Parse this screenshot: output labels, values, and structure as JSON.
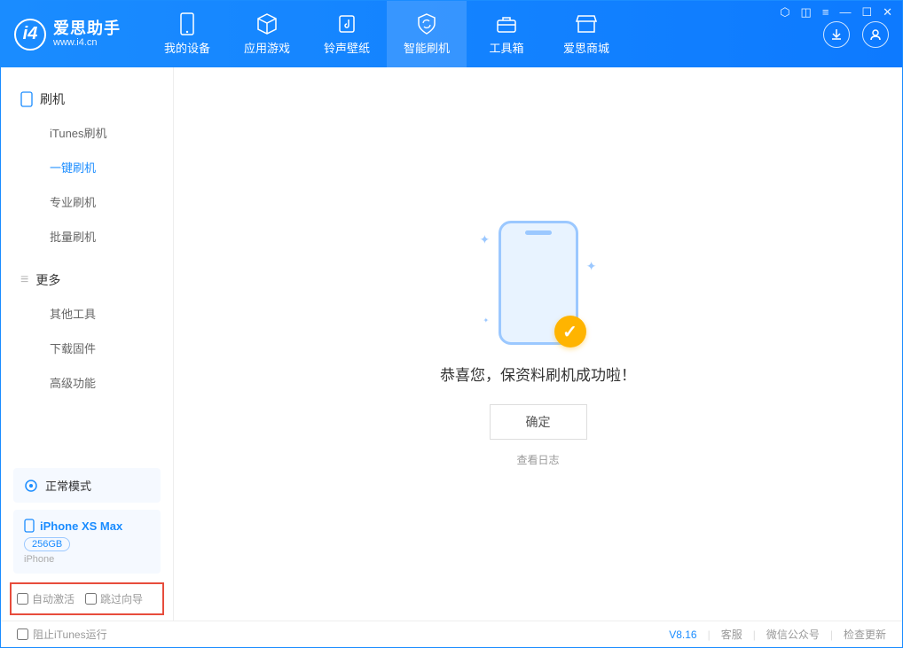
{
  "app": {
    "name": "爱思助手",
    "url": "www.i4.cn"
  },
  "nav": {
    "items": [
      {
        "label": "我的设备"
      },
      {
        "label": "应用游戏"
      },
      {
        "label": "铃声壁纸"
      },
      {
        "label": "智能刷机"
      },
      {
        "label": "工具箱"
      },
      {
        "label": "爱思商城"
      }
    ]
  },
  "sidebar": {
    "section1_title": "刷机",
    "items1": [
      {
        "label": "iTunes刷机"
      },
      {
        "label": "一键刷机"
      },
      {
        "label": "专业刷机"
      },
      {
        "label": "批量刷机"
      }
    ],
    "section2_title": "更多",
    "items2": [
      {
        "label": "其他工具"
      },
      {
        "label": "下载固件"
      },
      {
        "label": "高级功能"
      }
    ],
    "mode": "正常模式",
    "device": {
      "name": "iPhone XS Max",
      "capacity": "256GB",
      "type": "iPhone"
    },
    "checkbox1": "自动激活",
    "checkbox2": "跳过向导"
  },
  "main": {
    "success_text": "恭喜您，保资料刷机成功啦！",
    "confirm": "确定",
    "view_log": "查看日志"
  },
  "footer": {
    "block_itunes": "阻止iTunes运行",
    "version": "V8.16",
    "links": [
      "客服",
      "微信公众号",
      "检查更新"
    ]
  }
}
